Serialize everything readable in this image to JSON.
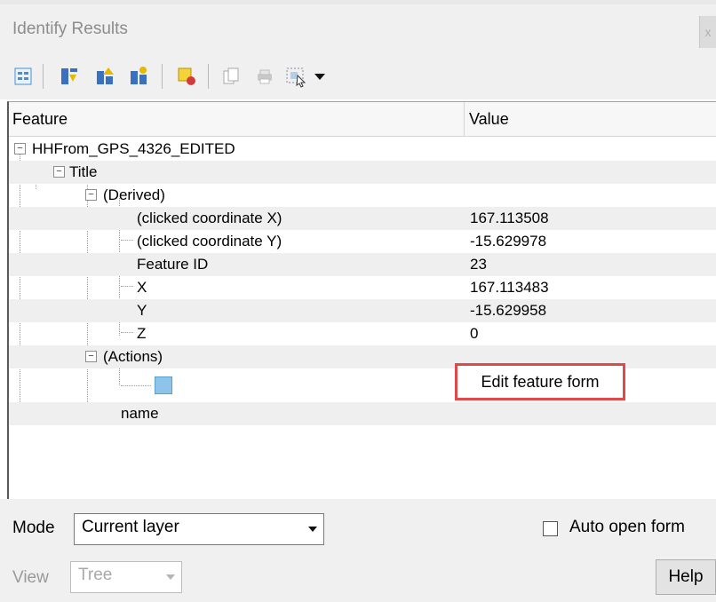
{
  "window": {
    "title": "Identify Results",
    "close_label": "x"
  },
  "toolbar": {
    "icons": [
      "expand-tree-icon",
      "expand-all-icon",
      "collapse-all-icon",
      "expand-new-icon",
      "clear-highlight-icon",
      "copy-feature-icon",
      "print-icon",
      "select-features-icon",
      "dropdown-arrow-icon"
    ]
  },
  "tree": {
    "headers": {
      "feature": "Feature",
      "value": "Value"
    },
    "rows": [
      {
        "label": "HHFrom_GPS_4326_EDITED",
        "value": ""
      },
      {
        "label": "Title",
        "value": ""
      },
      {
        "label": "(Derived)",
        "value": ""
      },
      {
        "label": "(clicked coordinate X)",
        "value": "167.113508"
      },
      {
        "label": "(clicked coordinate Y)",
        "value": "-15.629978"
      },
      {
        "label": "Feature ID",
        "value": "23"
      },
      {
        "label": "X",
        "value": "167.113483"
      },
      {
        "label": "Y",
        "value": "-15.629958"
      },
      {
        "label": "Z",
        "value": "0"
      },
      {
        "label": "(Actions)",
        "value": ""
      },
      {
        "label": "",
        "value": ""
      },
      {
        "label": "name",
        "value": ""
      }
    ],
    "action_button": "Edit feature form",
    "highlight_color": "#e0484a"
  },
  "bottom": {
    "mode_label": "Mode",
    "mode_value": "Current layer",
    "auto_open_label": "Auto open form",
    "auto_open_checked": false,
    "view_label": "View",
    "view_value": "Tree",
    "help_label": "Help"
  }
}
